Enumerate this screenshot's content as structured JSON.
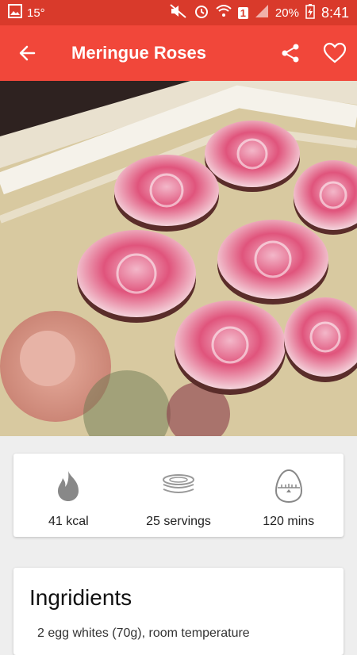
{
  "status_bar": {
    "temperature": "15°",
    "sim_badge": "1",
    "battery": "20%",
    "time": "8:41",
    "icons": [
      "gallery-icon",
      "mute-icon",
      "alarm-icon",
      "wifi-icon",
      "signal-icon",
      "battery-charging-icon"
    ]
  },
  "toolbar": {
    "title": "Meringue Roses",
    "back_icon": "back-arrow-icon",
    "share_icon": "share-icon",
    "favorite_icon": "heart-outline-icon"
  },
  "stats": [
    {
      "icon": "flame-icon",
      "label": "41 kcal"
    },
    {
      "icon": "plates-icon",
      "label": "25 servings"
    },
    {
      "icon": "egg-timer-icon",
      "label": "120 mins"
    }
  ],
  "ingredients": {
    "title": "Ingridients",
    "items": [
      "2 egg whites (70g), room temperature"
    ]
  },
  "colors": {
    "status_bar": "#d93a2b",
    "toolbar": "#f1473a",
    "background": "#eeeeee"
  }
}
